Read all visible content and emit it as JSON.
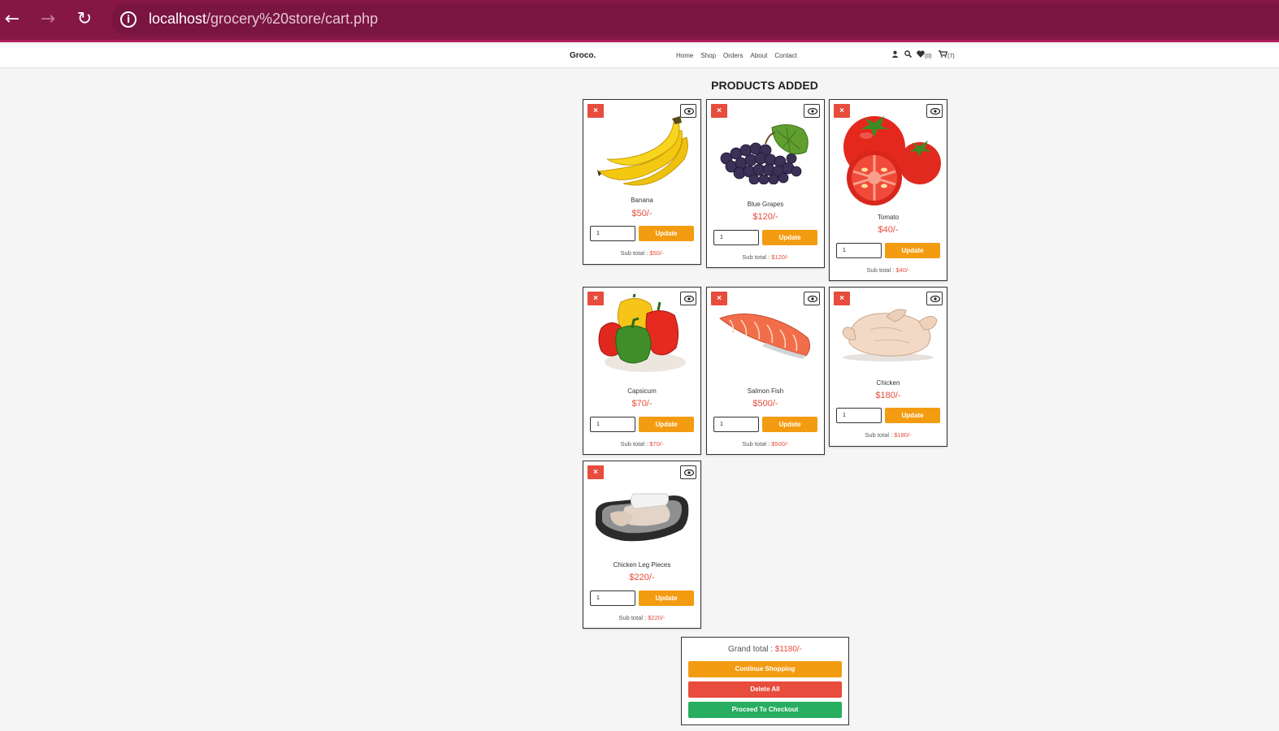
{
  "browser": {
    "url_host": "localhost",
    "url_path": "/grocery%20store/cart.php"
  },
  "header": {
    "logo": "Groco.",
    "nav": [
      "Home",
      "Shop",
      "Orders",
      "About",
      "Contact"
    ],
    "wishlist_count": "(0)",
    "cart_count": "(7)"
  },
  "page_title": "PRODUCTS ADDED",
  "labels": {
    "delete": "×",
    "update": "Update",
    "subtotal_prefix": "Sub total : "
  },
  "products": [
    {
      "name": "Banana",
      "price": "$50/-",
      "qty": "1",
      "subtotal": "$50/-"
    },
    {
      "name": "Blue Grapes",
      "price": "$120/-",
      "qty": "1",
      "subtotal": "$120/-"
    },
    {
      "name": "Tomato",
      "price": "$40/-",
      "qty": "1",
      "subtotal": "$40/-"
    },
    {
      "name": "Capsicum",
      "price": "$70/-",
      "qty": "1",
      "subtotal": "$70/-"
    },
    {
      "name": "Salmon Fish",
      "price": "$500/-",
      "qty": "1",
      "subtotal": "$500/-"
    },
    {
      "name": "Chicken",
      "price": "$180/-",
      "qty": "1",
      "subtotal": "$180/-"
    },
    {
      "name": "Chicken Leg Pieces",
      "price": "$220/-",
      "qty": "1",
      "subtotal": "$220/-"
    }
  ],
  "summary": {
    "grand_total_label": "Grand total : ",
    "grand_total": "$1180/-",
    "continue_label": "Continue Shopping",
    "delete_all_label": "Delete All",
    "checkout_label": "Proceed To Checkout"
  },
  "colors": {
    "browser_bar": "#851745",
    "accent_orange": "#f39c12",
    "danger_red": "#e74c3c",
    "success_green": "#27ae60"
  }
}
